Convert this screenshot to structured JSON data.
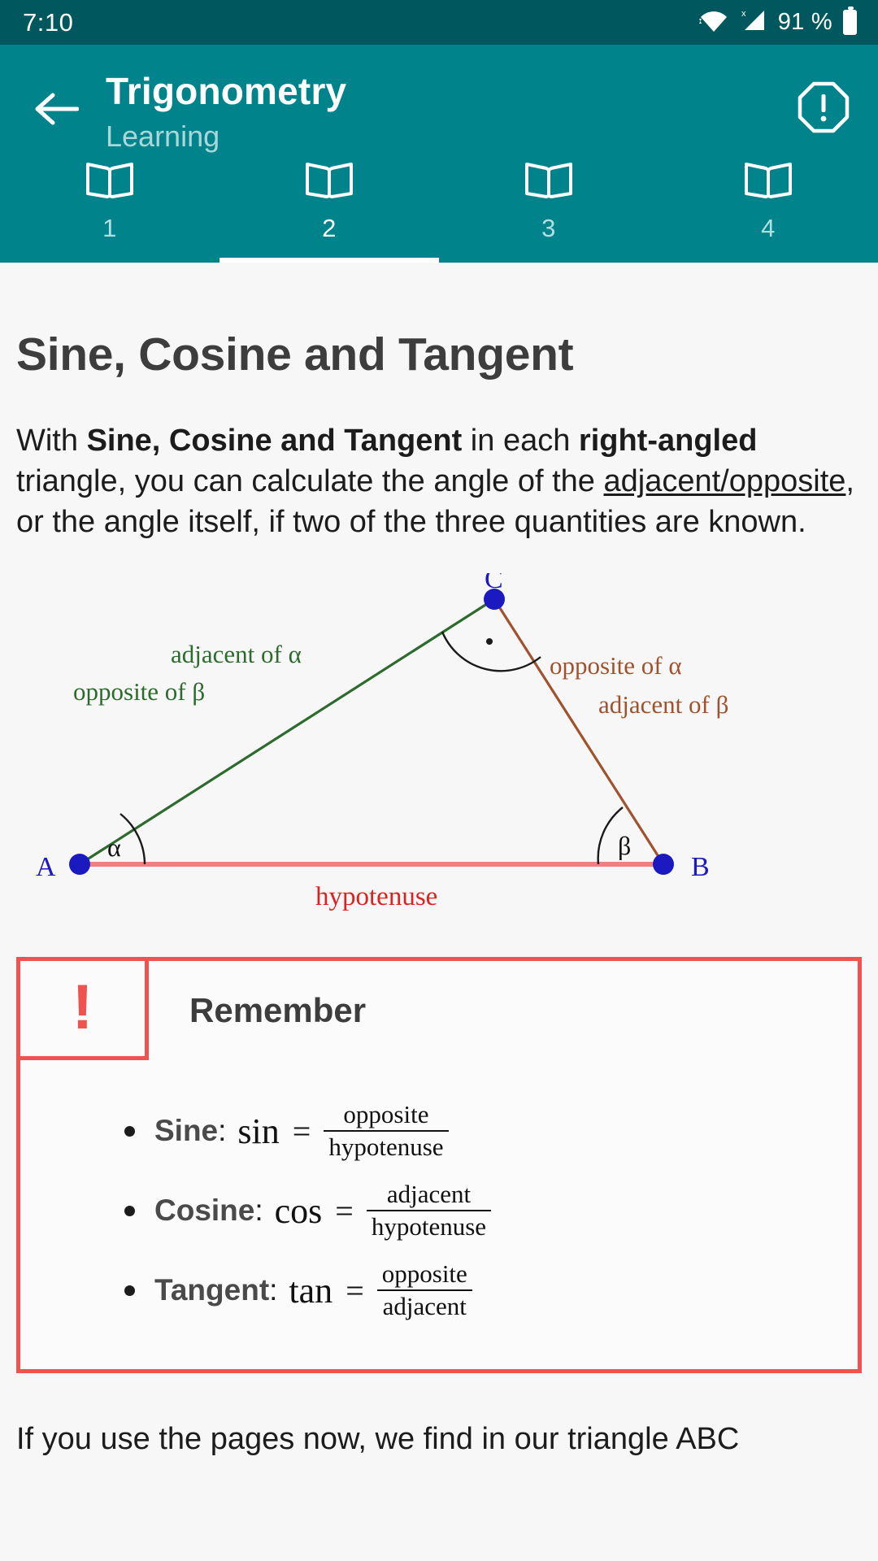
{
  "status_bar": {
    "time": "7:10",
    "battery_pct": "91 %",
    "icons": [
      "wifi-icon",
      "signal-icon",
      "battery-icon"
    ]
  },
  "app_bar": {
    "back_icon": "back-arrow-icon",
    "title": "Trigonometry",
    "subtitle": "Learning",
    "warning_icon": "warning-octagon-icon"
  },
  "tabs": {
    "active_index": 1,
    "items": [
      {
        "label": "1",
        "icon": "book-icon"
      },
      {
        "label": "2",
        "icon": "book-icon"
      },
      {
        "label": "3",
        "icon": "book-icon"
      },
      {
        "label": "4",
        "icon": "book-icon"
      }
    ]
  },
  "content": {
    "heading": "Sine, Cosine and Tangent",
    "paragraph": {
      "p1": "With ",
      "bold1": "Sine, Cosine and Tangent",
      "p2": " in each ",
      "bold2": "right-angled",
      "p3": " triangle, you can calculate the angle of the ",
      "link": "adjacent/opposite",
      "p4": ", or the angle itself, if two of the three quantities are known."
    },
    "diagram": {
      "vertex_a": "A",
      "vertex_b": "B",
      "vertex_c": "C",
      "angle_alpha": "α",
      "angle_beta": "β",
      "label_adjacent_alpha": "adjacent of α",
      "label_opposite_beta": "opposite of β",
      "label_opposite_alpha": "opposite of α",
      "label_adjacent_beta": "adjacent of β",
      "label_hypotenuse": "hypotenuse",
      "colors": {
        "green_side": "#2d6a2d",
        "brown_side": "#a0522d",
        "hypotenuse": "#f08080",
        "hypotenuse_label": "#e02020",
        "vertex_dot": "#1a1ac0",
        "vertex_label": "#1a1ac0",
        "angle_arc": "#1a1a1a"
      }
    },
    "remember": {
      "bang": "!",
      "title": "Remember",
      "border_color": "#ef5350",
      "formulas": [
        {
          "name": "Sine",
          "colon": ":",
          "fn": "sin",
          "op": "=",
          "numerator": "opposite",
          "denominator": "hypotenuse"
        },
        {
          "name": "Cosine",
          "colon": ":",
          "fn": "cos",
          "op": "=",
          "numerator": "adjacent",
          "denominator": "hypotenuse"
        },
        {
          "name": "Tangent",
          "colon": ":",
          "fn": "tan",
          "op": "=",
          "numerator": "opposite",
          "denominator": "adjacent"
        }
      ]
    },
    "tail_paragraph": "If you use the pages now, we find in our triangle ABC"
  },
  "theme": {
    "status_bar_bg": "#00585e",
    "app_bar_bg": "#00838a",
    "page_bg": "#f7f7f7",
    "heading_color": "#3d3d3d",
    "accent_red": "#ef5350"
  }
}
